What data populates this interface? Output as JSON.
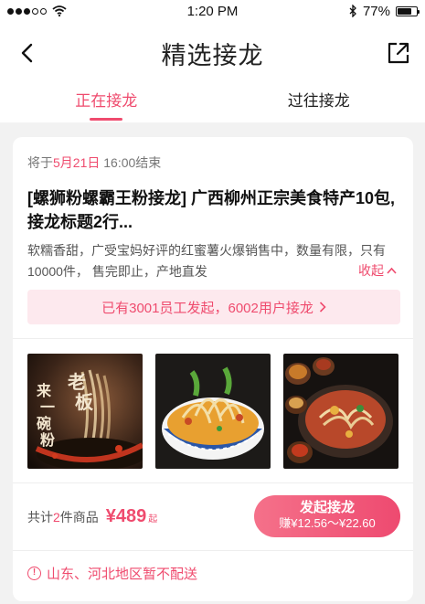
{
  "status_bar": {
    "time": "1:20 PM",
    "battery": "77%",
    "battery_level": 0.77
  },
  "header": {
    "title": "精选接龙"
  },
  "tabs": [
    {
      "label": "正在接龙",
      "active": true
    },
    {
      "label": "过往接龙",
      "active": false
    }
  ],
  "card": {
    "deadline_prefix": "将于",
    "deadline_date": "5月21日",
    "deadline_time": " 16:00",
    "deadline_suffix": "结束",
    "title": "[螺狮粉螺霸王粉接龙] 广西柳州正宗美食特产10包,接龙标题2行...",
    "description": "软糯香甜，广受宝妈好评的红蜜薯火爆销售中，数量有限，只有10000件，  售完即止，产地直发",
    "collapse_label": "收起",
    "banner_text": "已有3001员工发起，6002用户接龙",
    "images": [
      {
        "name": "product-image-1",
        "caption": "老板来一碗粉"
      },
      {
        "name": "product-image-2"
      },
      {
        "name": "product-image-3"
      }
    ],
    "summary_prefix": "共计",
    "summary_count": "2",
    "summary_suffix": "件商品",
    "price": "¥489",
    "price_suffix": "起",
    "start_button": {
      "label": "发起接龙",
      "earn": "赚¥12.56～¥22.60"
    },
    "notice": "山东、河北地区暂不配送"
  },
  "colors": {
    "accent": "#ef4b6e",
    "banner_bg": "#fde9ee"
  }
}
